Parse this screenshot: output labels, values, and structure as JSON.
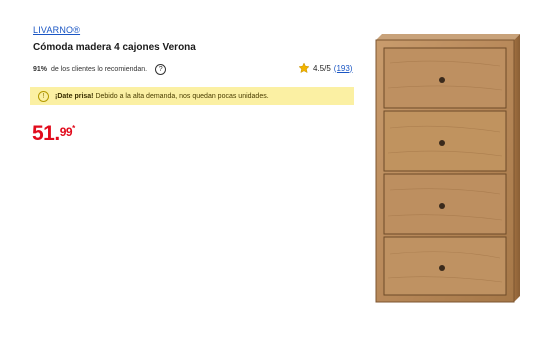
{
  "product": {
    "brand": "LIVARNO®",
    "title": "Cómoda madera 4 cajones Verona",
    "recommend_pct": "91%",
    "recommend_text": "de los clientes lo recomiendan.",
    "rating": "4.5/5",
    "rating_count": "(193)",
    "alert_strong": "¡Date prisa!",
    "alert_text": "Debido a la alta demanda, nos quedan pocas unidades.",
    "price_whole": "51.",
    "price_cents": "99",
    "price_mark": "*"
  },
  "colors": {
    "brand_link": "#1a56c4",
    "price_red": "#e10b1c",
    "alert_bg": "#fbf0a3",
    "star": "#f2b400",
    "wood": "#b8895a"
  },
  "icons": {
    "help": "question-circle-icon",
    "star": "star-icon",
    "alert": "clock-icon"
  }
}
